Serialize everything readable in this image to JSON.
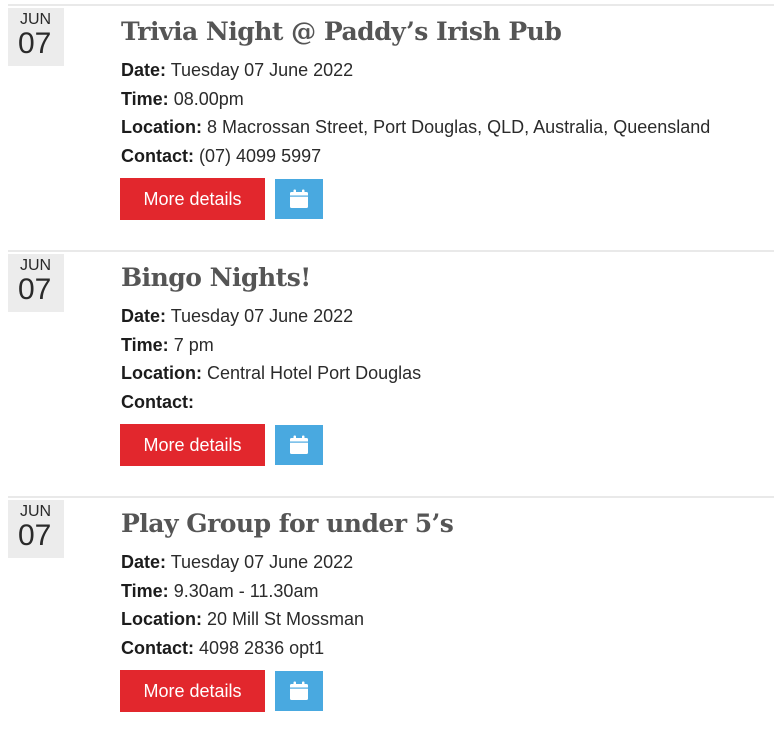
{
  "events": [
    {
      "month": "JUN",
      "day": "07",
      "title": "Trivia Night @ Paddy’s Irish Pub",
      "date_label": "Date:",
      "date": "Tuesday 07 June 2022",
      "time_label": "Time:",
      "time": "08.00pm",
      "location_label": "Location:",
      "location": "8 Macrossan Street, Port Douglas, QLD, Australia, Queensland",
      "contact_label": "Contact:",
      "contact": "(07) 4099 5997",
      "more_label": "More details",
      "calendar_icon": "calendar-icon"
    },
    {
      "month": "JUN",
      "day": "07",
      "title": "Bingo Nights!",
      "date_label": "Date:",
      "date": "Tuesday 07 June 2022",
      "time_label": "Time:",
      "time": "7 pm",
      "location_label": "Location:",
      "location": "Central Hotel Port Douglas",
      "contact_label": "Contact:",
      "contact": "",
      "more_label": "More details",
      "calendar_icon": "calendar-icon"
    },
    {
      "month": "JUN",
      "day": "07",
      "title": "Play Group for under 5’s",
      "date_label": "Date:",
      "date": "Tuesday 07 June 2022",
      "time_label": "Time:",
      "time": "9.30am - 11.30am",
      "location_label": "Location:",
      "location": "20 Mill St Mossman",
      "contact_label": "Contact:",
      "contact": "4098 2836 opt1",
      "more_label": "More details",
      "calendar_icon": "calendar-icon"
    }
  ],
  "colors": {
    "more_button": "#e2272d",
    "calendar_button": "#49a9e0",
    "date_badge": "#ececec",
    "title": "#555555"
  }
}
